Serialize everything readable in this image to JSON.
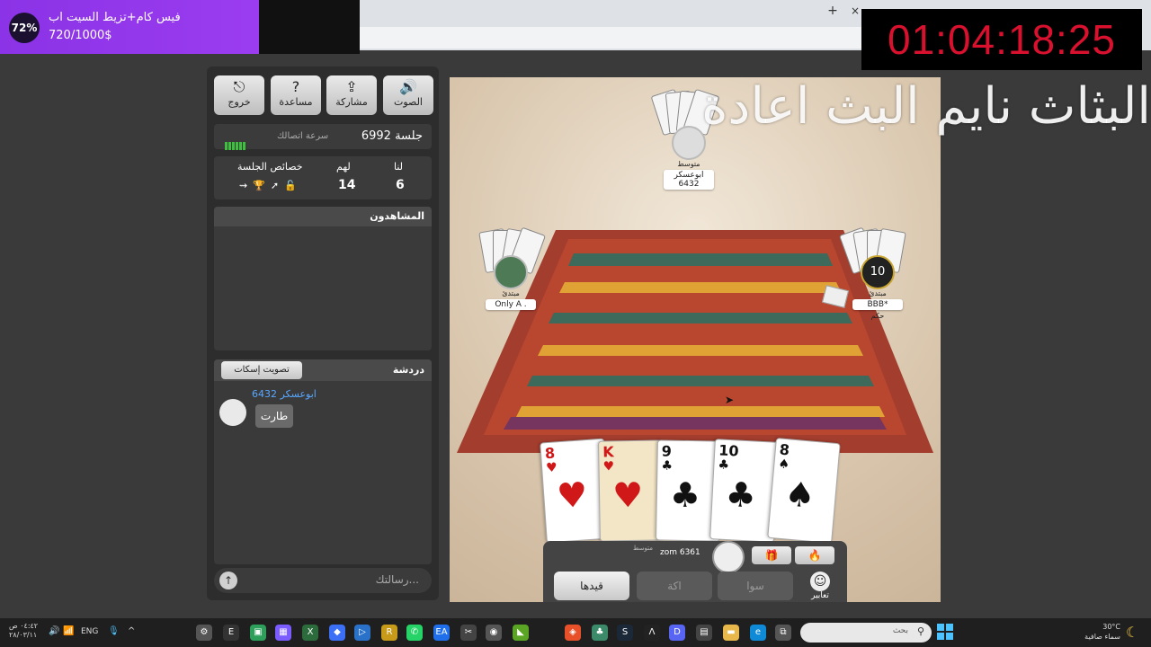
{
  "browser": {
    "new_tab": "+",
    "close_tab": "×"
  },
  "donation": {
    "percent": "72%",
    "title": "فيس كام+تزيط السيت اب",
    "amount": "720/1000$"
  },
  "timer": "01:04:18:25",
  "overlay_text": "البثاث نايم البث اعادة",
  "panel": {
    "buttons": [
      {
        "label": "الصوت",
        "icon": "🔊"
      },
      {
        "label": "مشاركة",
        "icon": "⇪"
      },
      {
        "label": "مساعدة",
        "icon": "?"
      },
      {
        "label": "خروج",
        "icon": "⎋"
      }
    ],
    "session_label": "جلسة 6992",
    "speed_label": "سرعة اتصالك",
    "stats": {
      "us_label": "لنا",
      "them_label": "لهم",
      "props_label": "خصائص الجلسة",
      "us": "6",
      "them": "14",
      "props_icons": "⇝🏆➚🔓"
    },
    "viewers_title": "المشاهدون",
    "chat": {
      "title": "دردشة",
      "mute_button": "تصويت إسكات",
      "sender": "ابوعسكر 6432",
      "message": "طارت"
    },
    "message_placeholder": "رسالتك...",
    "send_icon": "↑"
  },
  "players": {
    "top": {
      "level": "متوسط",
      "name": "ابوعسكر 6432"
    },
    "left": {
      "level": "مبتدئ",
      "name": "Only A ."
    },
    "right": {
      "level": "مبتدئ",
      "name": "BBB*",
      "badge": "10",
      "trump_label": "حكم"
    },
    "me": {
      "name": "zom 6361",
      "level": "متوسط"
    }
  },
  "hand": [
    {
      "rank": "8",
      "suit": "♥",
      "color": "red"
    },
    {
      "rank": "K",
      "suit": "♥",
      "color": "red"
    },
    {
      "rank": "9",
      "suit": "♣",
      "color": "blk"
    },
    {
      "rank": "10",
      "suit": "♣",
      "color": "blk"
    },
    {
      "rank": "8",
      "suit": "♠",
      "color": "blk"
    }
  ],
  "actions": {
    "qaydha": "قيدها",
    "akka": "اكة",
    "sawa": "سوا",
    "emotes": "تعابير"
  },
  "taskbar": {
    "time": "٠٤:٤٢ ص",
    "date": "٢٨/٠٣/١١",
    "lang": "ENG",
    "search_placeholder": "بحث",
    "weather_temp": "30°C",
    "weather_desc": "سماء صافية"
  }
}
